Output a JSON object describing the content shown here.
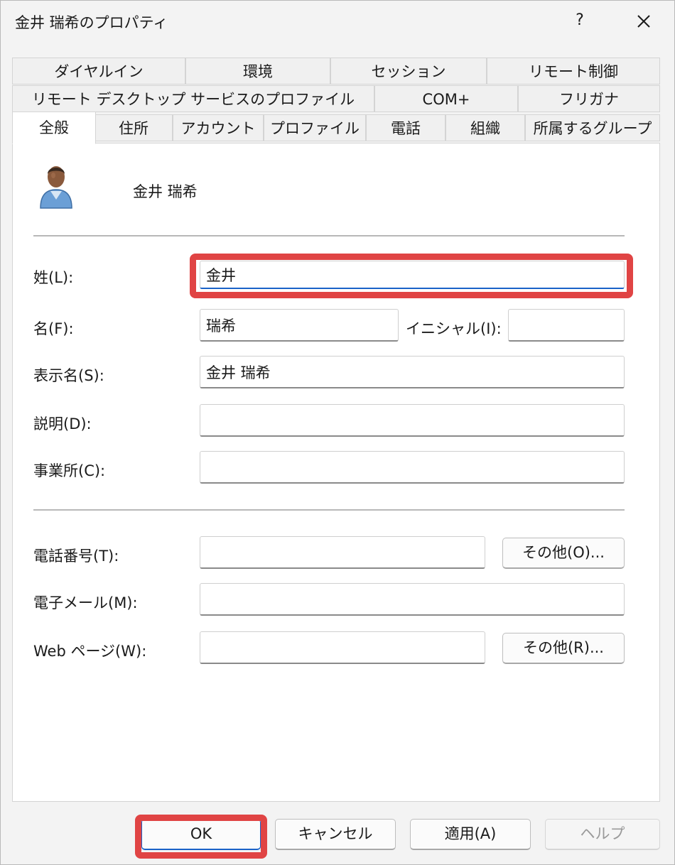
{
  "window": {
    "title": "金井 瑞希のプロパティ",
    "help_label": "?"
  },
  "tabs": {
    "row1": [
      "ダイヤルイン",
      "環境",
      "セッション",
      "リモート制御"
    ],
    "row2": [
      "リモート デスクトップ サービスのプロファイル",
      "COM+",
      "フリガナ"
    ],
    "row3": [
      "全般",
      "住所",
      "アカウント",
      "プロファイル",
      "電話",
      "組織",
      "所属するグループ"
    ]
  },
  "general": {
    "user_display": "金井 瑞希",
    "last_name_label": "姓(L):",
    "last_name_value": "金井",
    "first_name_label": "名(F):",
    "first_name_value": "瑞希",
    "initials_label": "イニシャル(I):",
    "initials_value": "",
    "display_name_label": "表示名(S):",
    "display_name_value": "金井 瑞希",
    "description_label": "説明(D):",
    "description_value": "",
    "office_label": "事業所(C):",
    "office_value": "",
    "phone_label": "電話番号(T):",
    "phone_value": "",
    "phone_other_label": "その他(O)...",
    "email_label": "電子メール(M):",
    "email_value": "",
    "web_label": "Web ページ(W):",
    "web_value": "",
    "web_other_label": "その他(R)..."
  },
  "footer": {
    "ok_label": "OK",
    "cancel_label": "キャンセル",
    "apply_label": "適用(A)",
    "help_label": "ヘルプ"
  },
  "highlight_color": "#e04444"
}
